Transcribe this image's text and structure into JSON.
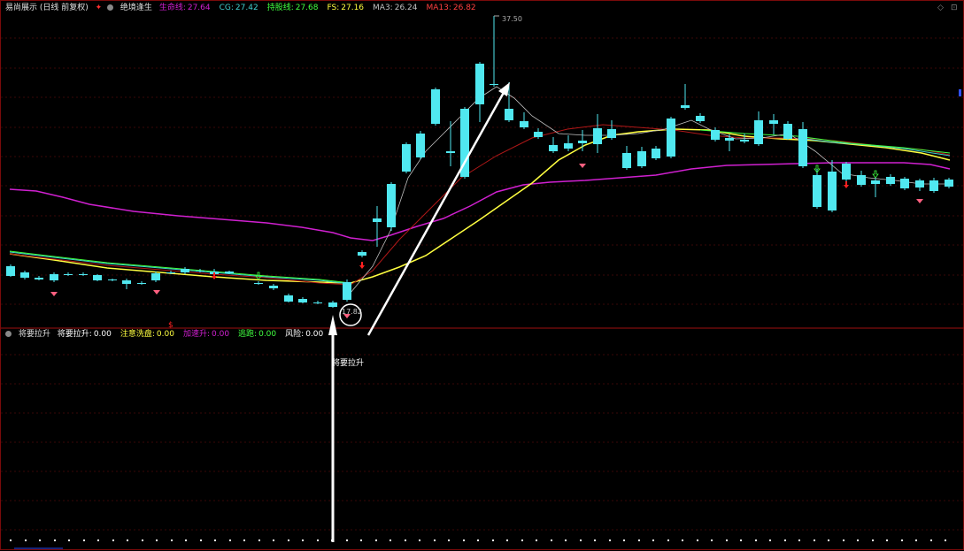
{
  "header": {
    "title": "易尚展示 (日线 前复权)",
    "indicator_name": "绝境逢生",
    "items": [
      {
        "label": "生命线:",
        "value": "27.64",
        "color": "#d020d0"
      },
      {
        "label": "CG:",
        "value": "27.42",
        "color": "#40d0d0"
      },
      {
        "label": "持股线:",
        "value": "27.68",
        "color": "#40ff40"
      },
      {
        "label": "FS:",
        "value": "27.16",
        "color": "#ffff40"
      },
      {
        "label": "MA3:",
        "value": "26.24",
        "color": "#c0c0c0"
      },
      {
        "label": "MA13:",
        "value": "26.82",
        "color": "#ff4040"
      }
    ]
  },
  "subheader": {
    "name": "将要拉升",
    "items": [
      {
        "label": "将要拉升:",
        "value": "0.00",
        "color": "#ffffff"
      },
      {
        "label": "注意洗盘:",
        "value": "0.00",
        "color": "#ffff40"
      },
      {
        "label": "加速升:",
        "value": "0.00",
        "color": "#d020d0"
      },
      {
        "label": "逃跑:",
        "value": "0.00",
        "color": "#40ff40"
      },
      {
        "label": "风险:",
        "value": "0.00",
        "color": "#ffffff"
      }
    ]
  },
  "annotations": {
    "high_price": "37.50",
    "low_price": "17.82",
    "arrow_label": "将要拉升"
  },
  "corner_controls": {
    "left": "◇",
    "right": "⊡"
  },
  "colors": {
    "up": "#ff3030",
    "down": "#50e8f0",
    "life_line": "#d020d0",
    "fs": "#ffff40"
  }
}
